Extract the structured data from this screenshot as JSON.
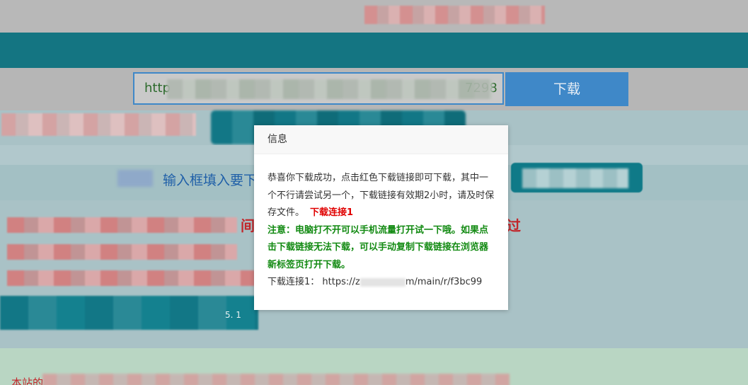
{
  "page": {
    "url_prefix": "http",
    "url_suffix": "7298",
    "download_button": "下载",
    "hint_text": "输入框填入要下",
    "side_text_char": "间",
    "side_text_right": "过",
    "bottom_teal_label": "5. 1",
    "footer_text": "本站的"
  },
  "modal": {
    "title": "信息",
    "message": "恭喜你下载成功，点击红色下载链接即可下载，其中一个不行请尝试另一个，下载链接有效期2小时，请及时保存文件。",
    "link_label": "下载连接1",
    "note": "注意：电脑打不开可以手机流量打开试一下哦。如果点击下载链接无法下载，可以手动复制下载链接在浏览器新标签页打开下载。",
    "link_line_prefix": "下载连接1：",
    "link_line_url_start": "https://z",
    "link_line_url_end": "m/main/r/f3bc99"
  },
  "colors": {
    "teal": "#147582",
    "blue_button": "#3f88c8",
    "red_link": "#e00000",
    "green_note": "#128a12"
  }
}
